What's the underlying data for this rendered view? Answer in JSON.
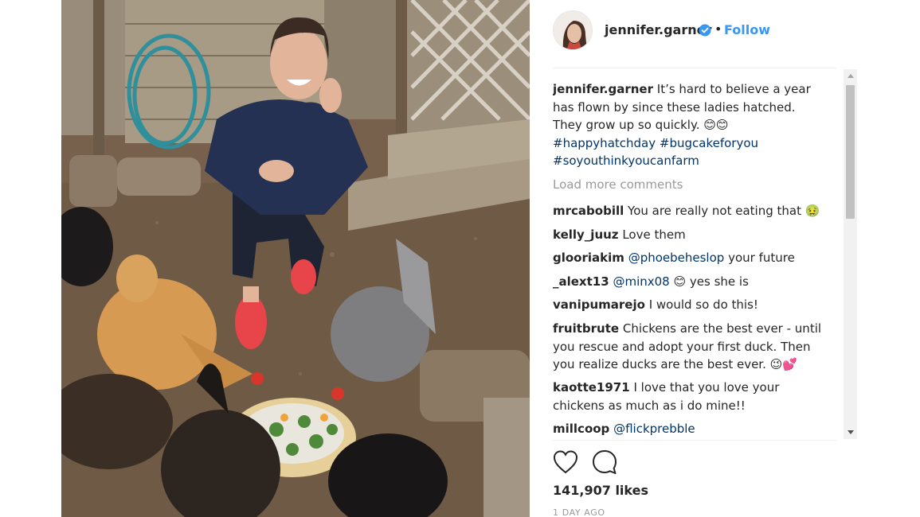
{
  "post": {
    "photo_alt": "Woman crouching with chickens around a tortilla cake in a backyard coop",
    "colors": {
      "follow": "#3897f0",
      "hashtag": "#003569",
      "muted": "#999999",
      "text": "#262626"
    }
  },
  "header": {
    "avatar_icon": "profile-avatar",
    "username": "jennifer.garner",
    "verified_icon": "verified-badge-icon",
    "separator": "•",
    "follow_label": "Follow"
  },
  "caption": {
    "username": "jennifer.garner",
    "text": "It’s hard to believe a year has flown by since these ladies hatched. They grow up so quickly. 😊😊",
    "hashtags": [
      "#happyhatchday",
      "#bugcakeforyou",
      "#soyouthinkyoucanfarm"
    ]
  },
  "load_more": "Load more comments",
  "comments": [
    {
      "user": "mrcabobill",
      "text": "You are really not eating that 🤢"
    },
    {
      "user": "kelly_juuz",
      "text": "Love them"
    },
    {
      "user": "glooriakim",
      "mention": "@phoebeheslop",
      "text": "your future"
    },
    {
      "user": "_alext13",
      "mention": "@minx08",
      "text": "😊 yes she is"
    },
    {
      "user": "vanipumarejo",
      "text": "I would so do this!"
    },
    {
      "user": "fruitbrute",
      "text": "Chickens are the best ever - until you rescue and adopt your first duck. Then you realize ducks are the best ever. 😉💕"
    },
    {
      "user": "kaotte1971",
      "text": "I love that you love your chickens as much as i do mine!!"
    },
    {
      "user": "millcoop",
      "mention": "@flickprebble",
      "text": ""
    }
  ],
  "actions": {
    "like_icon": "heart-icon",
    "comment_icon": "comment-bubble-icon"
  },
  "likes": "141,907 likes",
  "time": "1 DAY AGO"
}
